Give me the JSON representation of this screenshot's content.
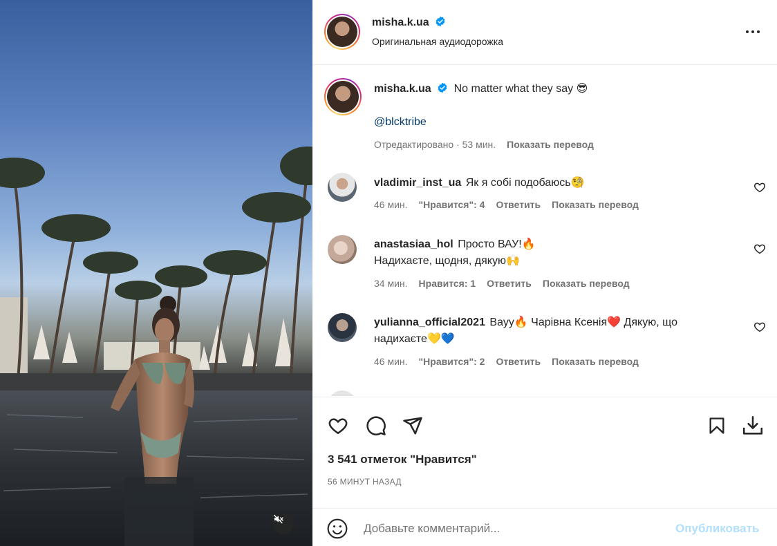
{
  "post": {
    "username": "misha.k.ua",
    "audio": "Оригинальная аудиодорожка",
    "verified": true
  },
  "caption": {
    "username": "misha.k.ua",
    "text": "No matter what they say 😎",
    "mention": "@blcktribe",
    "edited": "Отредактировано · 53 мин.",
    "translate": "Показать перевод"
  },
  "comments": [
    {
      "username": "vladimir_inst_ua",
      "text": "Як я собі подобаюсь🧐",
      "time": "46 мин.",
      "likes": "\"Нравится\": 4",
      "reply": "Ответить",
      "translate": "Показать перевод"
    },
    {
      "username": "anastasiaa_hol",
      "text": "Просто ВАУ!🔥",
      "text2": "Надихаєте, щодня, дякую🙌",
      "time": "34 мин.",
      "likes": "Нравится: 1",
      "reply": "Ответить",
      "translate": "Показать перевод"
    },
    {
      "username": "yulianna_official2021",
      "text": "Вауу🔥 Чарівна Ксенія❤️ Дякую, що",
      "text2": "надихаєте💛💙",
      "time": "46 мин.",
      "likes": "\"Нравится\": 2",
      "reply": "Ответить",
      "translate": "Показать перевод"
    }
  ],
  "actions": {
    "like_icon": "heart-icon",
    "comment_icon": "comment-icon",
    "share_icon": "paper-plane-icon",
    "save_icon": "bookmark-icon",
    "download_icon": "download-icon"
  },
  "likes_text": "3 541 отметок \"Нравится\"",
  "time_ago": "56 МИНУТ НАЗАД",
  "add_comment": {
    "placeholder": "Добавьте комментарий...",
    "publish": "Опубликовать",
    "emoji_icon": "smiley-icon"
  },
  "media": {
    "mute_icon": "speaker-muted-icon"
  },
  "colors": {
    "link": "#00376b",
    "muted": "#737373",
    "publish_disabled": "#b2dffc",
    "verified": "#0095f6"
  }
}
